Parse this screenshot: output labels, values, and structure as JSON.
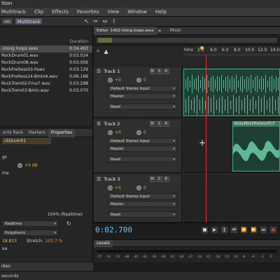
{
  "window": {
    "title": "ition"
  },
  "menu": [
    "Multitrack",
    "Clip",
    "Effects",
    "Favorites",
    "View",
    "Window",
    "Help"
  ],
  "toolbar": {
    "files_tab": "rm",
    "multitrack_tab": "Multitrack"
  },
  "files": {
    "column_duration": "Duration",
    "items": [
      {
        "name": "-Using loops.sesx",
        "duration": "0:34.463"
      },
      {
        "name": "RockDrum01.wav",
        "duration": "0:03.024"
      },
      {
        "name": "RockDrum08.wav",
        "duration": "0:03.056"
      },
      {
        "name": "RockFretless03-Fawv",
        "duration": "0:03.129"
      },
      {
        "name": "RockFretless14-BminA.wav",
        "duration": "0:06.168"
      },
      {
        "name": "RockTrem02-Fma7.wav",
        "duration": "0:03.298"
      },
      {
        "name": "RockTrem03-Bmin.wav",
        "duration": "0:03.070"
      }
    ]
  },
  "props_panel": {
    "tabs": [
      "ects Rack",
      "Markers",
      "Properties"
    ],
    "clip_name": "ckDrum01",
    "label_gs": "gs",
    "volume": "+0 dB",
    "label_me": "me",
    "percent": "104% (Realtime)",
    "mode": "Realtime",
    "algorithm": "Polyphonic",
    "value_a": "18.813",
    "stretch_label": "Stretch:",
    "stretch_value": "103.7 %",
    "label_ea": "ea",
    "bottom_label": "ideo"
  },
  "editor": {
    "tab_label": "Editor: 1402-Using loops.sesx",
    "mixer_tab": "Mixer",
    "ruler": [
      "hms",
      "2.0",
      "4.0",
      "6.0",
      "8.0",
      "10.0",
      "12.0",
      "14.0"
    ],
    "tracks": [
      {
        "name": "Track 1",
        "vol": "+0",
        "pan": "0",
        "input": "Default Stereo Input",
        "output": "Master",
        "mode": "Read"
      },
      {
        "name": "Track 2",
        "vol": "+0",
        "pan": "0",
        "input": "Default Stereo Input",
        "output": "Master",
        "mode": "Read",
        "clip": "BalladRockFretless05-F"
      },
      {
        "name": "Track 3",
        "vol": "+0",
        "pan": "0",
        "input": "Default Stereo Input",
        "output": "Master",
        "mode": "Read"
      }
    ],
    "m_label": "M",
    "s_label": "S",
    "r_label": "R"
  },
  "transport": {
    "time": "0:02.700"
  },
  "levels": {
    "label": "Levels",
    "ticks": [
      "-57",
      "-54",
      "-51",
      "-48",
      "-45",
      "-42",
      "-39",
      "-36",
      "-33",
      "-30",
      "-27",
      "-24",
      "-21",
      "-18",
      "-15",
      "-12",
      "-9",
      "-6",
      "-3",
      "0"
    ]
  },
  "status": {
    "text": "seconds"
  },
  "colors": {
    "accent": "#e8a22c",
    "clip_green": "#3f7a62",
    "time_blue": "#5ec3ff",
    "playhead": "#d33"
  }
}
